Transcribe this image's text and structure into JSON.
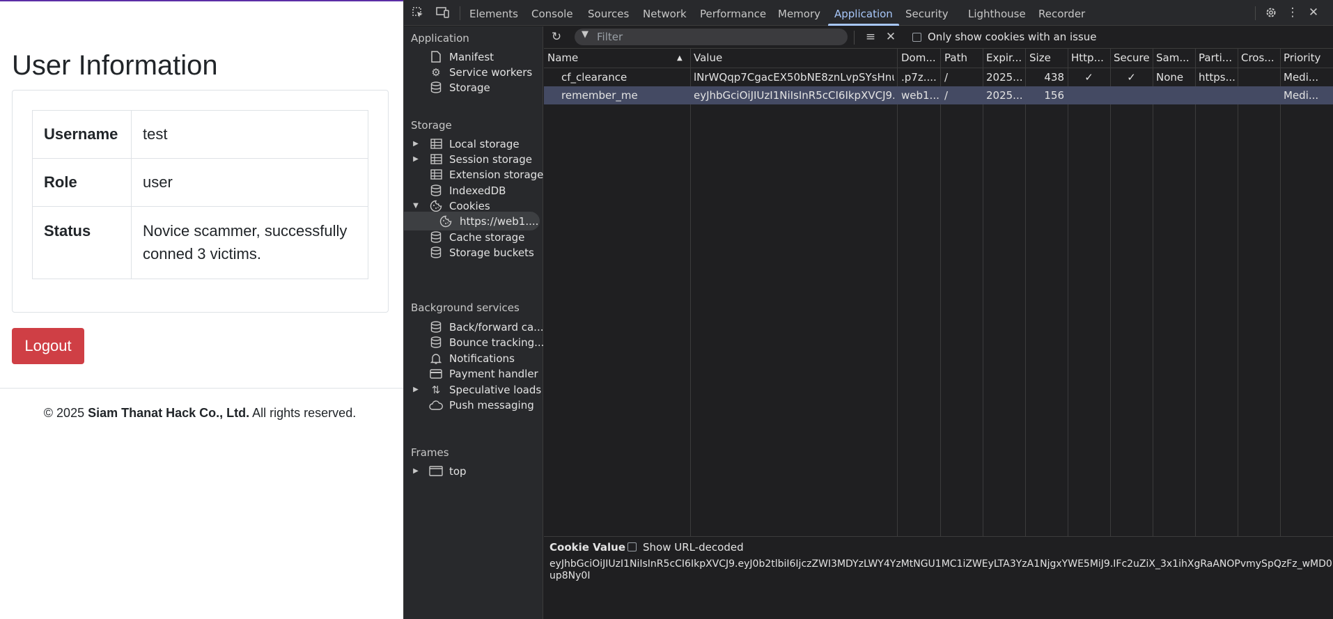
{
  "page": {
    "title": "User Information",
    "rows": [
      {
        "key": "Username",
        "value": "test"
      },
      {
        "key": "Role",
        "value": "user"
      },
      {
        "key": "Status",
        "value": "Novice scammer, successfully conned 3 victims."
      }
    ],
    "logout_label": "Logout",
    "footer": {
      "prefix": "© 2025 ",
      "company": "Siam Thanat Hack Co., Ltd.",
      "suffix": " All rights reserved."
    }
  },
  "devtools": {
    "tabs": [
      "Elements",
      "Console",
      "Sources",
      "Network",
      "Performance",
      "Memory",
      "Application",
      "Security",
      "Lighthouse",
      "Recorder"
    ],
    "active_tab": "Application",
    "sidebar": {
      "application_header": "Application",
      "application_items": [
        "Manifest",
        "Service workers",
        "Storage"
      ],
      "storage_header": "Storage",
      "storage_items": [
        "Local storage",
        "Session storage",
        "Extension storage",
        "IndexedDB",
        "Cookies",
        "https://web1....",
        "Cache storage",
        "Storage buckets"
      ],
      "background_header": "Background services",
      "background_items": [
        "Back/forward ca...",
        "Bounce tracking...",
        "Notifications",
        "Payment handler",
        "Speculative loads",
        "Push messaging"
      ],
      "frames_header": "Frames",
      "frames_items": [
        "top"
      ]
    },
    "filter": {
      "placeholder": "Filter",
      "issue_checkbox_label": "Only show cookies with an issue"
    },
    "columns": [
      "Name",
      "Value",
      "Dom...",
      "Path",
      "Expir...",
      "Size",
      "Http...",
      "Secure",
      "Sam...",
      "Parti...",
      "Cros...",
      "Priority"
    ],
    "cookies": [
      {
        "name": "cf_clearance",
        "value": "lNrWQqp7CgacEX50bNE8znLvpSYsHnu...",
        "domain": ".p7z....",
        "path": "/",
        "expires": "2025...",
        "size": "438",
        "http": "✓",
        "secure": "✓",
        "samesite": "None",
        "partition": "https...",
        "cross": "",
        "priority": "Medi..."
      },
      {
        "name": "remember_me",
        "value": "eyJhbGciOiJIUzI1NiIsInR5cCI6IkpXVCJ9....",
        "domain": "web1...",
        "path": "/",
        "expires": "2025...",
        "size": "156",
        "http": "",
        "secure": "",
        "samesite": "",
        "partition": "",
        "cross": "",
        "priority": "Medi..."
      }
    ],
    "selected_row": 1,
    "cookie_value": {
      "label": "Cookie Value",
      "checkbox_label": "Show URL-decoded",
      "text": "eyJhbGciOiJIUzI1NiIsInR5cCI6IkpXVCJ9.eyJ0b2tlbiI6IjczZWI3MDYzLWY4YzMtNGU1MC1iZWEyLTA3YzA1NjgxYWE5MiJ9.IFc2uZiX_3x1ihXgRaANOPvmySpQzFz_wMD0up8Ny0I"
    },
    "colors": {
      "accent": "#a8c7fa",
      "selected_row": "#444a63",
      "logout": "#cf3f45"
    }
  }
}
